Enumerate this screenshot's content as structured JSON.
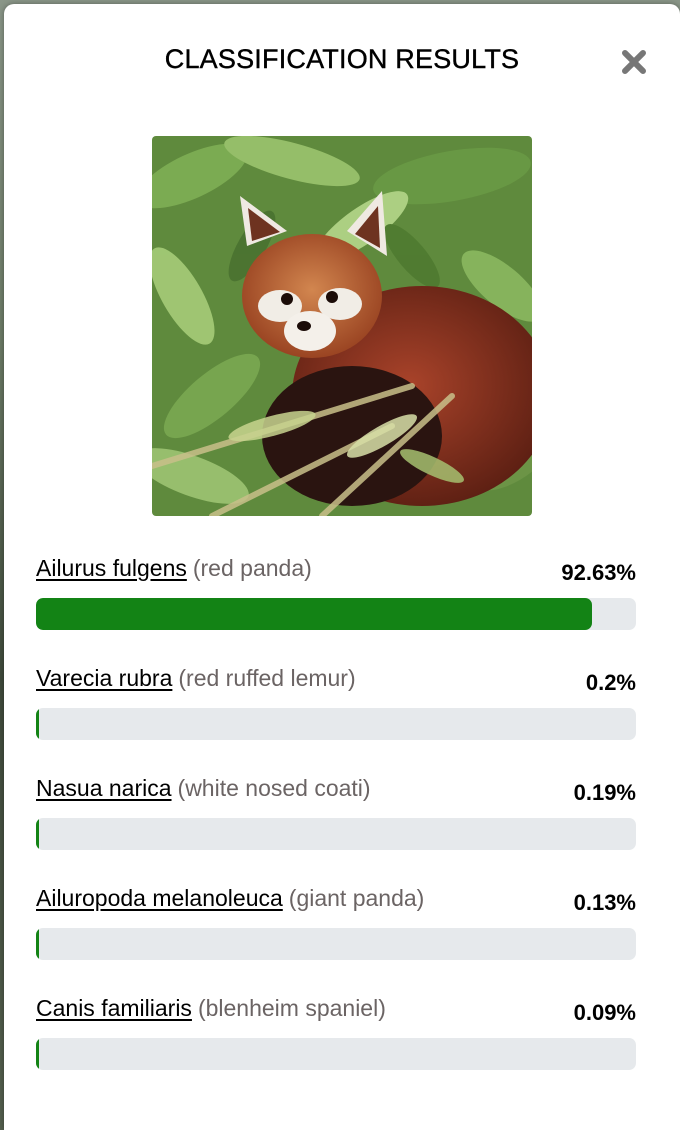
{
  "modal": {
    "title": "CLASSIFICATION RESULTS",
    "close_icon": "close-icon"
  },
  "photo": {
    "subject": "red-panda-photo"
  },
  "colors": {
    "bar_fill": "#138315",
    "bar_track": "#e6e9ec",
    "common_name": "#6b6464"
  },
  "results": [
    {
      "scientific": "Ailurus fulgens",
      "common": "(red panda)",
      "percent_label": "92.63%",
      "fraction": 0.9263
    },
    {
      "scientific": "Varecia rubra",
      "common": "(red ruffed lemur)",
      "percent_label": "0.2%",
      "fraction": 0.002
    },
    {
      "scientific": "Nasua narica",
      "common": "(white nosed coati)",
      "percent_label": "0.19%",
      "fraction": 0.0019
    },
    {
      "scientific": "Ailuropoda melanoleuca",
      "common": "(giant panda)",
      "percent_label": "0.13%",
      "fraction": 0.0013
    },
    {
      "scientific": "Canis familiaris",
      "common": "(blenheim spaniel)",
      "percent_label": "0.09%",
      "fraction": 0.0009
    }
  ]
}
